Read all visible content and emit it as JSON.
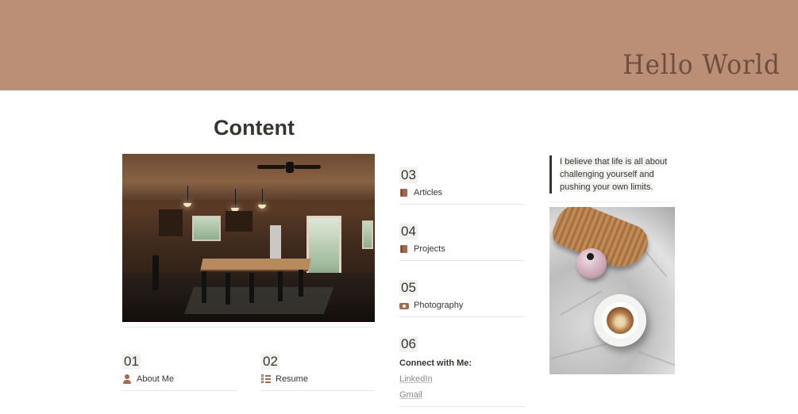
{
  "banner": {
    "title": "Hello World",
    "color": "#bb8f75"
  },
  "page": {
    "title": "Content"
  },
  "images": {
    "kitchen_photo": "kitchen-photo",
    "coffee_photo": "coffee-photo"
  },
  "sections": [
    {
      "num": "01",
      "label": "About Me",
      "icon": "person-icon"
    },
    {
      "num": "02",
      "label": "Resume",
      "icon": "checklist-icon"
    },
    {
      "num": "03",
      "label": "Articles",
      "icon": "book-icon"
    },
    {
      "num": "04",
      "label": "Projects",
      "icon": "book-icon"
    },
    {
      "num": "05",
      "label": "Photography",
      "icon": "camera-icon"
    }
  ],
  "connect": {
    "num": "06",
    "label": "Connect with Me:",
    "links": [
      "LinkedIn",
      "Gmail"
    ]
  },
  "quote": {
    "lines": [
      "I believe that life is all about",
      "challenging yourself and",
      "pushing your own limits."
    ]
  },
  "colors": {
    "accent_icon": "#a06a4f",
    "text": "#37352f",
    "highlight_bg": "#f1f1ef"
  }
}
